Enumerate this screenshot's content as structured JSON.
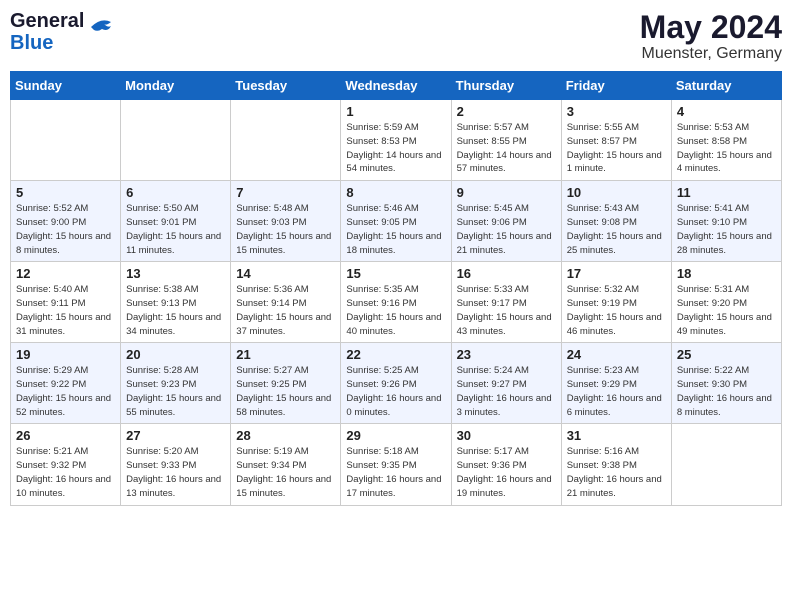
{
  "header": {
    "logo_line1": "General",
    "logo_line2": "Blue",
    "month": "May 2024",
    "location": "Muenster, Germany"
  },
  "weekdays": [
    "Sunday",
    "Monday",
    "Tuesday",
    "Wednesday",
    "Thursday",
    "Friday",
    "Saturday"
  ],
  "weeks": [
    [
      {
        "day": "",
        "detail": ""
      },
      {
        "day": "",
        "detail": ""
      },
      {
        "day": "",
        "detail": ""
      },
      {
        "day": "1",
        "detail": "Sunrise: 5:59 AM\nSunset: 8:53 PM\nDaylight: 14 hours\nand 54 minutes."
      },
      {
        "day": "2",
        "detail": "Sunrise: 5:57 AM\nSunset: 8:55 PM\nDaylight: 14 hours\nand 57 minutes."
      },
      {
        "day": "3",
        "detail": "Sunrise: 5:55 AM\nSunset: 8:57 PM\nDaylight: 15 hours\nand 1 minute."
      },
      {
        "day": "4",
        "detail": "Sunrise: 5:53 AM\nSunset: 8:58 PM\nDaylight: 15 hours\nand 4 minutes."
      }
    ],
    [
      {
        "day": "5",
        "detail": "Sunrise: 5:52 AM\nSunset: 9:00 PM\nDaylight: 15 hours\nand 8 minutes."
      },
      {
        "day": "6",
        "detail": "Sunrise: 5:50 AM\nSunset: 9:01 PM\nDaylight: 15 hours\nand 11 minutes."
      },
      {
        "day": "7",
        "detail": "Sunrise: 5:48 AM\nSunset: 9:03 PM\nDaylight: 15 hours\nand 15 minutes."
      },
      {
        "day": "8",
        "detail": "Sunrise: 5:46 AM\nSunset: 9:05 PM\nDaylight: 15 hours\nand 18 minutes."
      },
      {
        "day": "9",
        "detail": "Sunrise: 5:45 AM\nSunset: 9:06 PM\nDaylight: 15 hours\nand 21 minutes."
      },
      {
        "day": "10",
        "detail": "Sunrise: 5:43 AM\nSunset: 9:08 PM\nDaylight: 15 hours\nand 25 minutes."
      },
      {
        "day": "11",
        "detail": "Sunrise: 5:41 AM\nSunset: 9:10 PM\nDaylight: 15 hours\nand 28 minutes."
      }
    ],
    [
      {
        "day": "12",
        "detail": "Sunrise: 5:40 AM\nSunset: 9:11 PM\nDaylight: 15 hours\nand 31 minutes."
      },
      {
        "day": "13",
        "detail": "Sunrise: 5:38 AM\nSunset: 9:13 PM\nDaylight: 15 hours\nand 34 minutes."
      },
      {
        "day": "14",
        "detail": "Sunrise: 5:36 AM\nSunset: 9:14 PM\nDaylight: 15 hours\nand 37 minutes."
      },
      {
        "day": "15",
        "detail": "Sunrise: 5:35 AM\nSunset: 9:16 PM\nDaylight: 15 hours\nand 40 minutes."
      },
      {
        "day": "16",
        "detail": "Sunrise: 5:33 AM\nSunset: 9:17 PM\nDaylight: 15 hours\nand 43 minutes."
      },
      {
        "day": "17",
        "detail": "Sunrise: 5:32 AM\nSunset: 9:19 PM\nDaylight: 15 hours\nand 46 minutes."
      },
      {
        "day": "18",
        "detail": "Sunrise: 5:31 AM\nSunset: 9:20 PM\nDaylight: 15 hours\nand 49 minutes."
      }
    ],
    [
      {
        "day": "19",
        "detail": "Sunrise: 5:29 AM\nSunset: 9:22 PM\nDaylight: 15 hours\nand 52 minutes."
      },
      {
        "day": "20",
        "detail": "Sunrise: 5:28 AM\nSunset: 9:23 PM\nDaylight: 15 hours\nand 55 minutes."
      },
      {
        "day": "21",
        "detail": "Sunrise: 5:27 AM\nSunset: 9:25 PM\nDaylight: 15 hours\nand 58 minutes."
      },
      {
        "day": "22",
        "detail": "Sunrise: 5:25 AM\nSunset: 9:26 PM\nDaylight: 16 hours\nand 0 minutes."
      },
      {
        "day": "23",
        "detail": "Sunrise: 5:24 AM\nSunset: 9:27 PM\nDaylight: 16 hours\nand 3 minutes."
      },
      {
        "day": "24",
        "detail": "Sunrise: 5:23 AM\nSunset: 9:29 PM\nDaylight: 16 hours\nand 6 minutes."
      },
      {
        "day": "25",
        "detail": "Sunrise: 5:22 AM\nSunset: 9:30 PM\nDaylight: 16 hours\nand 8 minutes."
      }
    ],
    [
      {
        "day": "26",
        "detail": "Sunrise: 5:21 AM\nSunset: 9:32 PM\nDaylight: 16 hours\nand 10 minutes."
      },
      {
        "day": "27",
        "detail": "Sunrise: 5:20 AM\nSunset: 9:33 PM\nDaylight: 16 hours\nand 13 minutes."
      },
      {
        "day": "28",
        "detail": "Sunrise: 5:19 AM\nSunset: 9:34 PM\nDaylight: 16 hours\nand 15 minutes."
      },
      {
        "day": "29",
        "detail": "Sunrise: 5:18 AM\nSunset: 9:35 PM\nDaylight: 16 hours\nand 17 minutes."
      },
      {
        "day": "30",
        "detail": "Sunrise: 5:17 AM\nSunset: 9:36 PM\nDaylight: 16 hours\nand 19 minutes."
      },
      {
        "day": "31",
        "detail": "Sunrise: 5:16 AM\nSunset: 9:38 PM\nDaylight: 16 hours\nand 21 minutes."
      },
      {
        "day": "",
        "detail": ""
      }
    ]
  ]
}
